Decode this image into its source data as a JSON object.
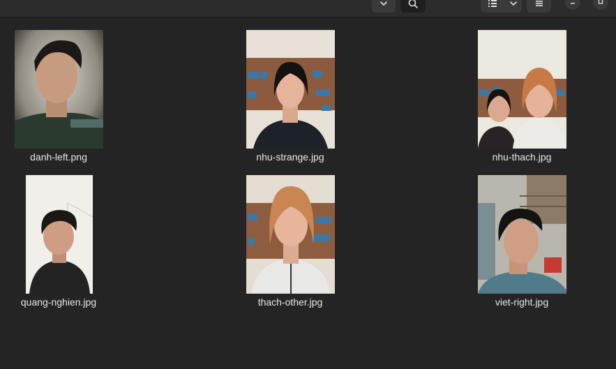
{
  "toolbar": {
    "icons": [
      "chevron-down-icon",
      "search-icon",
      "list-view-icon",
      "chevron-down-icon",
      "menu-icon",
      "minimize-icon",
      "maximize-icon"
    ]
  },
  "colors": {
    "window_bg": "#242424",
    "headerbar_bg": "#2c2c2c",
    "button_bg": "#3a3a3a",
    "label_text": "#e8e8e8"
  },
  "files": [
    {
      "name": "danh-left.png"
    },
    {
      "name": "nhu-strange.jpg"
    },
    {
      "name": "nhu-thach.jpg"
    },
    {
      "name": "quang-nghien.jpg"
    },
    {
      "name": "thach-other.jpg"
    },
    {
      "name": "viet-right.jpg"
    }
  ]
}
